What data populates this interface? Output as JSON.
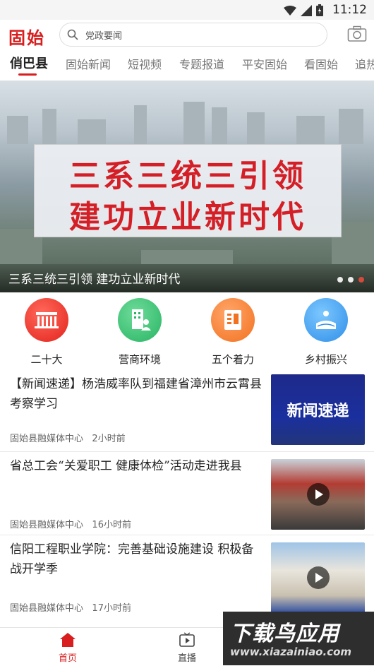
{
  "status_bar": {
    "time": "11:12"
  },
  "header": {
    "logo": "固始",
    "search_placeholder": "党政要闻"
  },
  "tabs": [
    {
      "label": "俏巴县"
    },
    {
      "label": "固始新闻"
    },
    {
      "label": "短视频"
    },
    {
      "label": "专题报道"
    },
    {
      "label": "平安固始"
    },
    {
      "label": "看固始"
    },
    {
      "label": "追热"
    }
  ],
  "banner": {
    "board_line1": "三系三统三引领",
    "board_line2": "建功立业新时代",
    "caption": "三系三统三引领  建功立业新时代"
  },
  "shortcuts": [
    {
      "label": "二十大",
      "icon": "hall-icon"
    },
    {
      "label": "营商环境",
      "icon": "building-person-icon"
    },
    {
      "label": "五个着力",
      "icon": "document-icon"
    },
    {
      "label": "乡村振兴",
      "icon": "farmland-sun-icon"
    }
  ],
  "news": [
    {
      "title": "【新闻速递】杨浩威率队到福建省漳州市云霄县考察学习",
      "source": "固始县融媒体中心",
      "time": "2小时前",
      "thumb_text": "新闻速递",
      "video": false
    },
    {
      "title": "省总工会“关爱职工 健康体检”活动走进我县",
      "source": "固始县融媒体中心",
      "time": "16小时前",
      "video": true
    },
    {
      "title": "信阳工程职业学院：完善基础设施建设 积极备战开学季",
      "source": "固始县融媒体中心",
      "time": "17小时前",
      "video": true
    }
  ],
  "bottom_nav": [
    {
      "label": "首页"
    },
    {
      "label": "直播"
    }
  ],
  "watermark": {
    "line1": "下载鸟应用",
    "line2": "www.xiazainiao.com"
  },
  "colors": {
    "accent": "#d81e1e"
  }
}
